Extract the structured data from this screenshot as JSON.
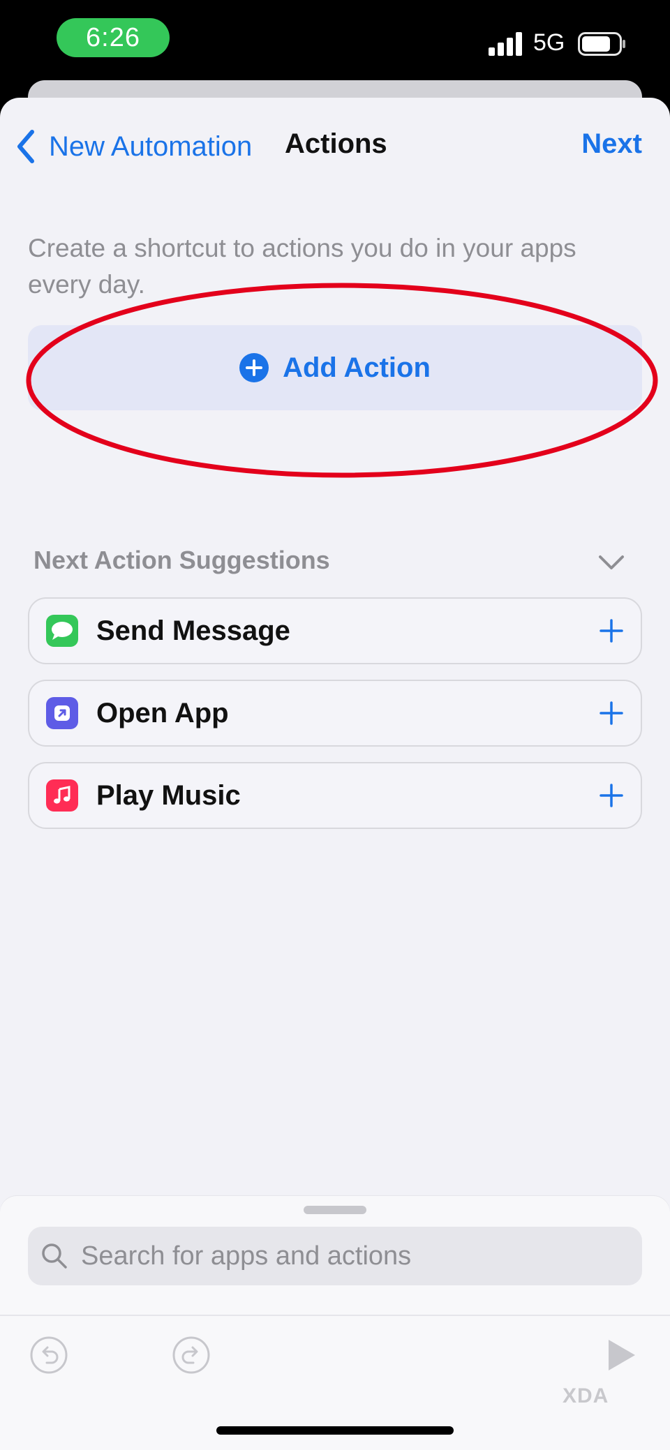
{
  "status_bar": {
    "time": "6:26",
    "network": "5G"
  },
  "nav": {
    "back_label": "New Automation",
    "title": "Actions",
    "next_label": "Next"
  },
  "description": "Create a shortcut to actions you do in your apps every day.",
  "add_action": {
    "label": "Add Action"
  },
  "suggestions": {
    "header": "Next Action Suggestions",
    "items": [
      {
        "label": "Send Message",
        "icon": "messages-icon",
        "color": "#34c759"
      },
      {
        "label": "Open App",
        "icon": "open-app-icon",
        "color": "#5e5ce6"
      },
      {
        "label": "Play Music",
        "icon": "music-icon",
        "color": "#ff2d55"
      }
    ]
  },
  "search": {
    "placeholder": "Search for apps and actions"
  },
  "watermark": "XDA",
  "colors": {
    "accent": "#1a73e8",
    "highlight_ring": "#e3001b",
    "status_pill": "#34c759"
  }
}
